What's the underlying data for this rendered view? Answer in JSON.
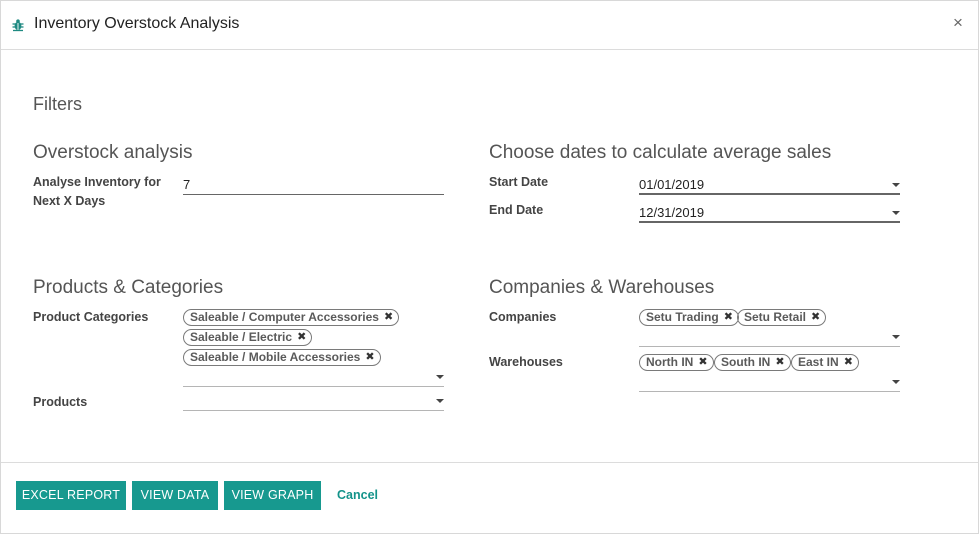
{
  "dialog": {
    "title": "Inventory Overstock Analysis",
    "close_label": "×"
  },
  "filters_heading": "Filters",
  "overstock": {
    "title": "Overstock analysis",
    "days_label_line1": "Analyse Inventory for",
    "days_label_line2": "Next X Days",
    "days_value": "7"
  },
  "dates": {
    "title": "Choose dates to calculate average sales",
    "start_label": "Start Date",
    "start_value": "01/01/2019",
    "end_label": "End Date",
    "end_value": "12/31/2019"
  },
  "products": {
    "title": "Products & Categories",
    "categories_label": "Product Categories",
    "categories": [
      "Saleable / Computer Accessories",
      "Saleable / Electric",
      "Saleable / Mobile Accessories"
    ],
    "products_label": "Products",
    "products_value": ""
  },
  "companies": {
    "title": "Companies & Warehouses",
    "companies_label": "Companies",
    "companies": [
      "Setu Trading",
      "Setu Retail"
    ],
    "warehouses_label": "Warehouses",
    "warehouses": [
      "North IN",
      "South IN",
      "East IN"
    ]
  },
  "footer": {
    "excel_label": "EXCEL REPORT",
    "view_data_label": "VIEW DATA",
    "view_graph_label": "VIEW GRAPH",
    "cancel_label": "Cancel"
  },
  "colors": {
    "accent": "#17998f",
    "link": "#13938a"
  }
}
